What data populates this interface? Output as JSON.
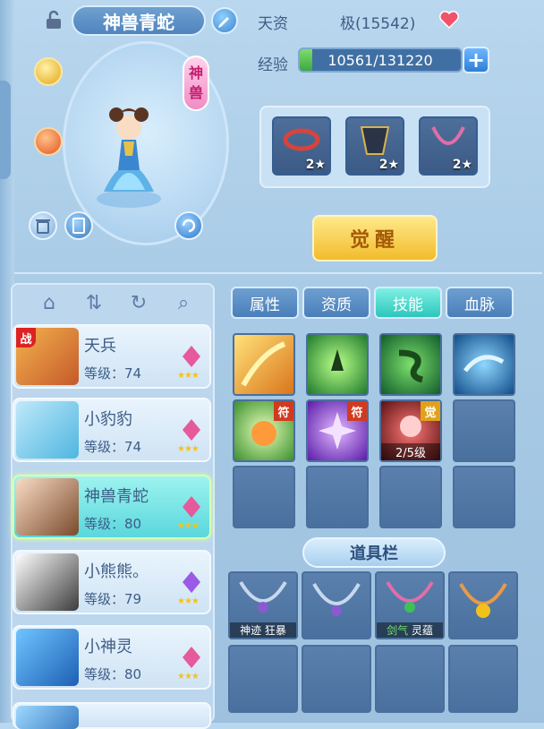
{
  "header": {
    "name": "神兽青蛇",
    "talent_label": "天资",
    "talent_value": "极(15542)",
    "exp_label": "经验",
    "exp_text": "10561/131220",
    "exp_progress": 0.0805,
    "exp_plus": "+"
  },
  "portrait": {
    "badge_top": "神",
    "badge_bottom": "兽"
  },
  "equipment": [
    {
      "stars": "2★"
    },
    {
      "stars": "2★"
    },
    {
      "stars": "2★"
    }
  ],
  "awaken_label": "觉醒",
  "tabs": [
    {
      "label": "属性",
      "active": false
    },
    {
      "label": "资质",
      "active": false
    },
    {
      "label": "技能",
      "active": true
    },
    {
      "label": "血脉",
      "active": false
    }
  ],
  "characters": [
    {
      "name": "天兵",
      "level": "等级：74",
      "badge": "战",
      "active": false
    },
    {
      "name": "小豹豹",
      "level": "等级：74",
      "active": false
    },
    {
      "name": "神兽青蛇",
      "level": "等级：80",
      "active": true
    },
    {
      "name": "小熊熊。",
      "level": "等级：79",
      "active": false
    },
    {
      "name": "小神灵",
      "level": "等级：80",
      "active": false
    }
  ],
  "skills": {
    "tag_fu": "符",
    "tag_jue": "觉",
    "level_text": "2/5级"
  },
  "tool_bar_title": "道具栏",
  "items": [
    {
      "label_a": "神迹",
      "label_b": "狂暴"
    },
    {
      "label_a": "",
      "label_b": ""
    },
    {
      "label_a": "剑气",
      "label_b": "灵蕴"
    },
    {
      "label_a": "",
      "label_b": ""
    }
  ],
  "colors": {
    "active_tab": "#2cc6bd",
    "awaken": "#f2bc2b",
    "exp_fill": "#3ca843"
  }
}
